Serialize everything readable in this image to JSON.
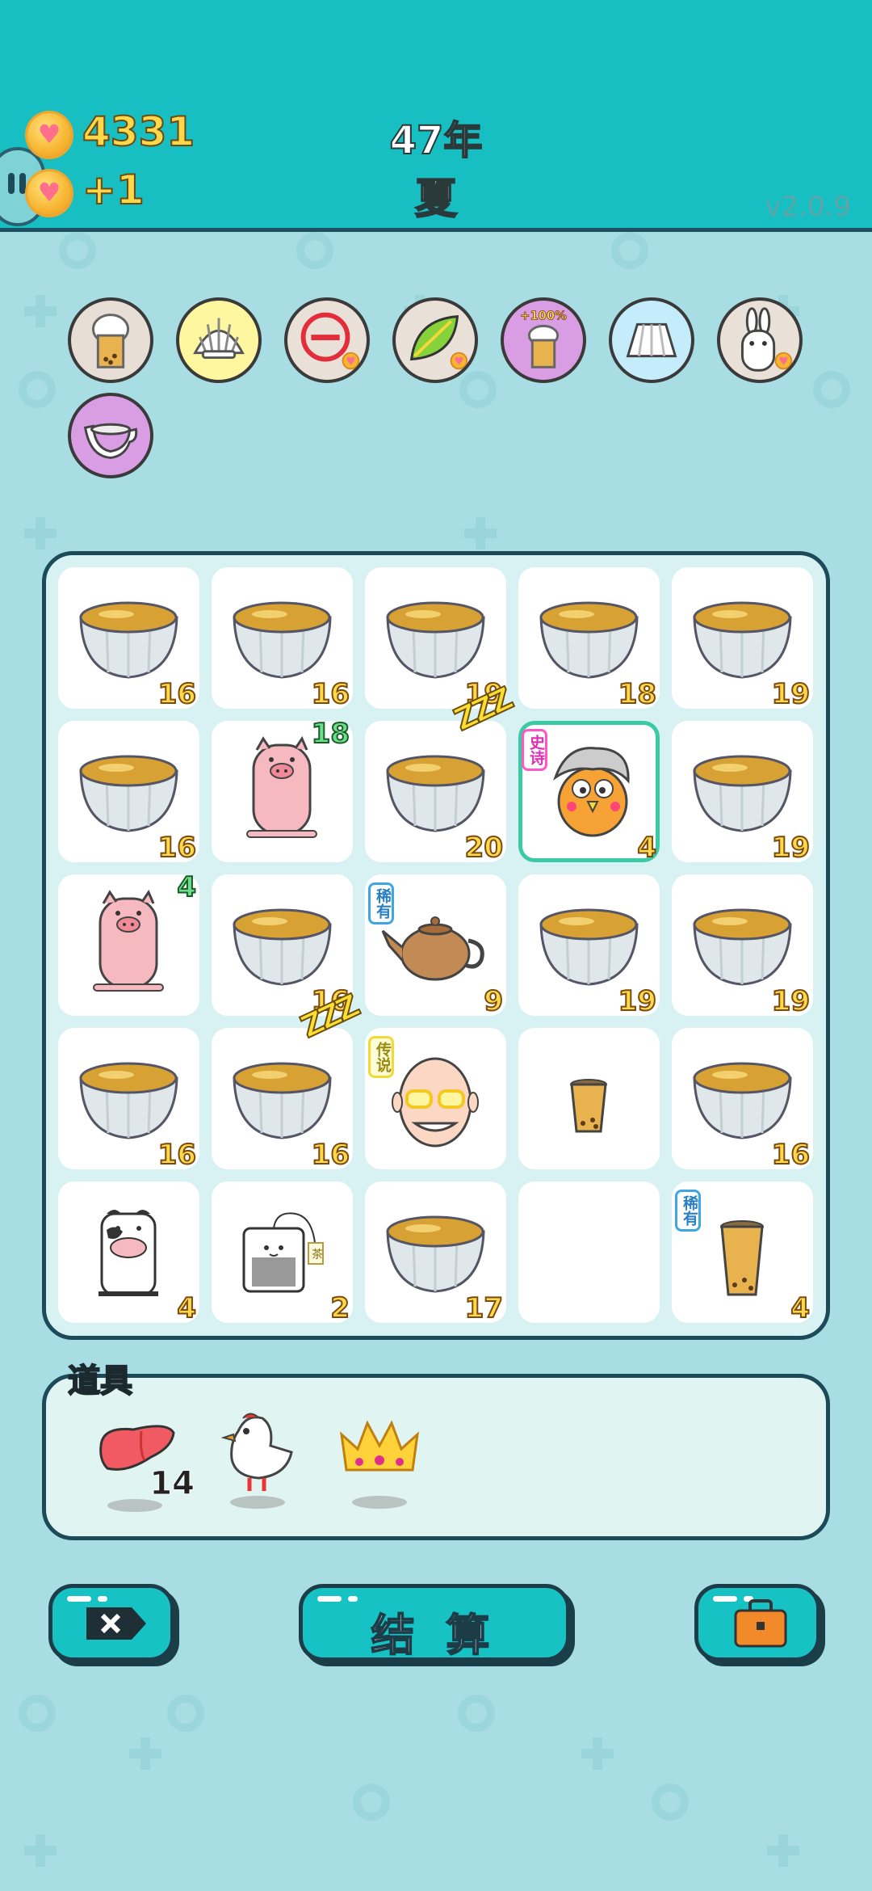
{
  "header": {
    "coins": "4331",
    "income": "+1",
    "year": "47年",
    "season": "夏",
    "version": "v2.0.9"
  },
  "buffs": [
    {
      "name": "bubble-tea-cup-buff-icon"
    },
    {
      "name": "shell-buff-icon"
    },
    {
      "name": "minus-buff-icon"
    },
    {
      "name": "leaf-buff-icon"
    },
    {
      "name": "plus-100-tea-buff-icon",
      "label": "+100%"
    },
    {
      "name": "skirt-buff-icon"
    },
    {
      "name": "rabbit-buff-icon"
    },
    {
      "name": "milk-jug-buff-icon"
    }
  ],
  "board": {
    "rows": [
      [
        {
          "item": "tea-bowl",
          "num": "16"
        },
        {
          "item": "tea-bowl",
          "num": "16"
        },
        {
          "item": "tea-bowl",
          "num": "19"
        },
        {
          "item": "tea-bowl",
          "num": "18"
        },
        {
          "item": "tea-bowl",
          "num": "19"
        }
      ],
      [
        {
          "item": "tea-bowl",
          "num": "16"
        },
        {
          "item": "pig",
          "num": "18"
        },
        {
          "item": "tea-bowl",
          "num": "20",
          "sleep": true
        },
        {
          "item": "old-man-bird",
          "num": "4",
          "tag": "史诗"
        },
        {
          "item": "tea-bowl",
          "num": "19"
        }
      ],
      [
        {
          "item": "pig",
          "num": "4"
        },
        {
          "item": "tea-bowl",
          "num": "16"
        },
        {
          "item": "teapot",
          "num": "9",
          "tag": "稀有"
        },
        {
          "item": "tea-bowl",
          "num": "19"
        },
        {
          "item": "tea-bowl",
          "num": "19"
        }
      ],
      [
        {
          "item": "tea-bowl",
          "num": "16"
        },
        {
          "item": "tea-bowl",
          "num": "16",
          "sleep": true
        },
        {
          "item": "bald-man",
          "tag": "传说"
        },
        {
          "item": "boba-cup-small"
        },
        {
          "item": "tea-bowl",
          "num": "16"
        }
      ],
      [
        {
          "item": "cow",
          "num": "4"
        },
        {
          "item": "tea-bag",
          "num": "2",
          "tagtext": "茶"
        },
        {
          "item": "tea-bowl",
          "num": "17"
        },
        {
          "item": "empty"
        },
        {
          "item": "boba-cup",
          "num": "4",
          "tag": "稀有"
        }
      ]
    ]
  },
  "props": {
    "title": "道具",
    "items": [
      {
        "name": "liver-icon",
        "count": "14"
      },
      {
        "name": "white-bird-icon"
      },
      {
        "name": "crown-icon"
      }
    ]
  },
  "buttons": {
    "close_label": "",
    "settle_label": "结 算",
    "bag_label": ""
  },
  "colors": {
    "header": "#17bfc2",
    "background": "#a8dde4",
    "number": "#ffd94a",
    "accent_border": "#1c4a58"
  }
}
